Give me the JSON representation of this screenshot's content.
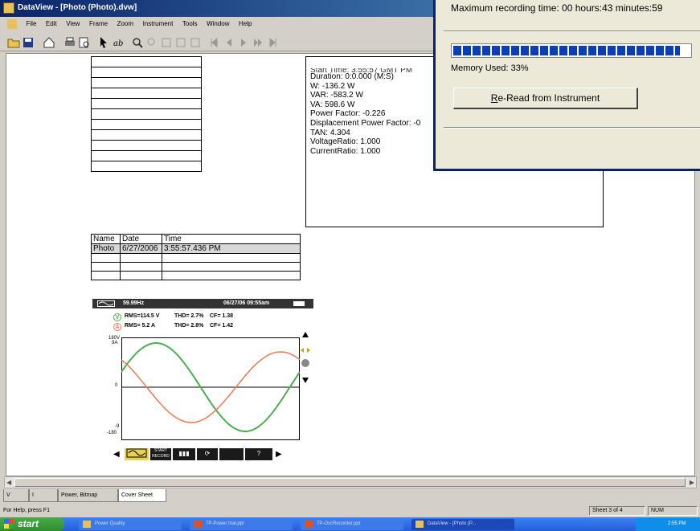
{
  "window": {
    "title": "DataView - [Photo (Photo).dvw]"
  },
  "menu": [
    "File",
    "Edit",
    "View",
    "Frame",
    "Zoom",
    "Instrument",
    "Tools",
    "Window",
    "Help"
  ],
  "info": {
    "partial_line": "Start Time: 3:55:57 GMT PM",
    "lines": [
      "Duration: 0:0.000 (M:S)",
      "W: -136.2 W",
      "VAR: -583.2 W",
      "VA: 598.6 W",
      "Power Factor: -0.226",
      "Displacement Power Factor: -0",
      "TAN: 4.304",
      "VoltageRatio: 1.000",
      "CurrentRatio: 1.000"
    ]
  },
  "photo_table": {
    "headers": [
      "Name",
      "Date",
      "Time"
    ],
    "rows": [
      [
        "Photo",
        "6/27/2006",
        "3:55:57.436 PM"
      ],
      [
        "",
        "",
        ""
      ],
      [
        "",
        "",
        ""
      ],
      [
        "",
        "",
        ""
      ]
    ]
  },
  "scope": {
    "freq": "59.99Hz",
    "datetime": "06/27/06 09:55am",
    "v_row": {
      "label": "V",
      "rms": "RMS=114.5 V",
      "thd": "THD= 2.7%",
      "cf": "CF= 1.38"
    },
    "a_row": {
      "label": "A",
      "rms": "RMS= 5.2 A",
      "thd": "THD= 2.8%",
      "cf": "CF= 1.42"
    },
    "y_top": "180V",
    "y_top2": "9A",
    "y_zero": "0",
    "y_bot": "-9",
    "y_bot2": "-180",
    "ctrl_help": "?",
    "ctrl_rec": "START RECORD"
  },
  "tabs": [
    "V",
    "I",
    "Power, Bitmap",
    "Cover Sheet"
  ],
  "status": {
    "help": "For Help, press F1",
    "sheet": "Sheet 3 of 4",
    "num": "NUM"
  },
  "taskbar": {
    "start": "start",
    "items": [
      "Power Quality",
      "7P-Power trial.ppt",
      "7P-OscRecorder.ppt",
      "DataView - [Photo (P..."
    ],
    "clock": "2:55 PM"
  },
  "dialog": {
    "max_time": "Maximum recording time: 00 hours:43 minutes:59",
    "memory": "Memory Used: 33%",
    "memory_fraction": 0.33,
    "reread_prefix": "R",
    "reread_rest": "e-Read from Instrument"
  },
  "colors": {
    "voltage": "#4caf50",
    "current": "#f07850",
    "title_bar": "#0a246a",
    "taskbar": "#245edb"
  }
}
